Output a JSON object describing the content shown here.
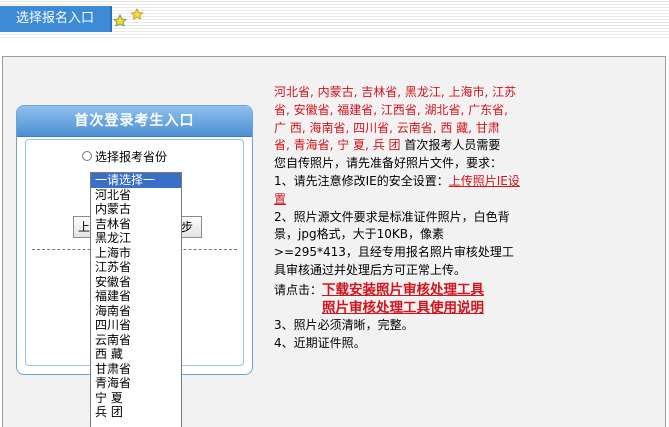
{
  "header": {
    "tab_label": "选择报名入口",
    "icons": [
      "star-green-icon",
      "star-yellow-icon"
    ]
  },
  "panel": {
    "title": "首次登录考生入口",
    "radio_label": "选择报考省份",
    "btn_left_label": "上",
    "btn_right_label": "步"
  },
  "dropdown": {
    "options": [
      "一请选择一",
      "河北省",
      "内蒙古",
      "吉林省",
      "黑龙江",
      "上海市",
      "江苏省",
      "安徽省",
      "福建省",
      "海南省",
      "四川省",
      "云南省",
      "西  藏",
      "甘肃省",
      "青海省",
      "宁  夏",
      "兵  团"
    ],
    "selected_index": 0
  },
  "info": {
    "provinces_line1": "河北省, 内蒙古, 吉林省, 黑龙江, 上海市, 江苏",
    "provinces_line2": "省, 安徽省, 福建省, 江西省, 湖北省, 广东省,",
    "provinces_line3": "广  西, 海南省, 四川省, 云南省, 西  藏, 甘肃",
    "provinces_line4": "省, 青海省, 宁  夏, 兵  团",
    "provinces_tail": " 首次报考人员需要",
    "line5": "您自传照片，请先准备好照片文件，要求：",
    "item1": "1、请先注意修改IE的安全设置：",
    "item1_link": "上传照片IE设置",
    "item2": "2、照片源文件要求是标准证件照片，白色背景，jpg格式，大于10KB，像素>=295*413，且经专用报名照片审核处理工具审核通过并处理后方可正常上传。",
    "click_label": "请点击：",
    "download_link": "下载安装照片审核处理工具",
    "manual_link": "照片审核处理工具使用说明",
    "item3": "3、照片必须清晰，完整。",
    "item4": "4、近期证件照。"
  },
  "colors": {
    "tab_blue": "#3d8bd6",
    "link_red": "#d2141e",
    "panel_border": "#6ea3d8"
  }
}
